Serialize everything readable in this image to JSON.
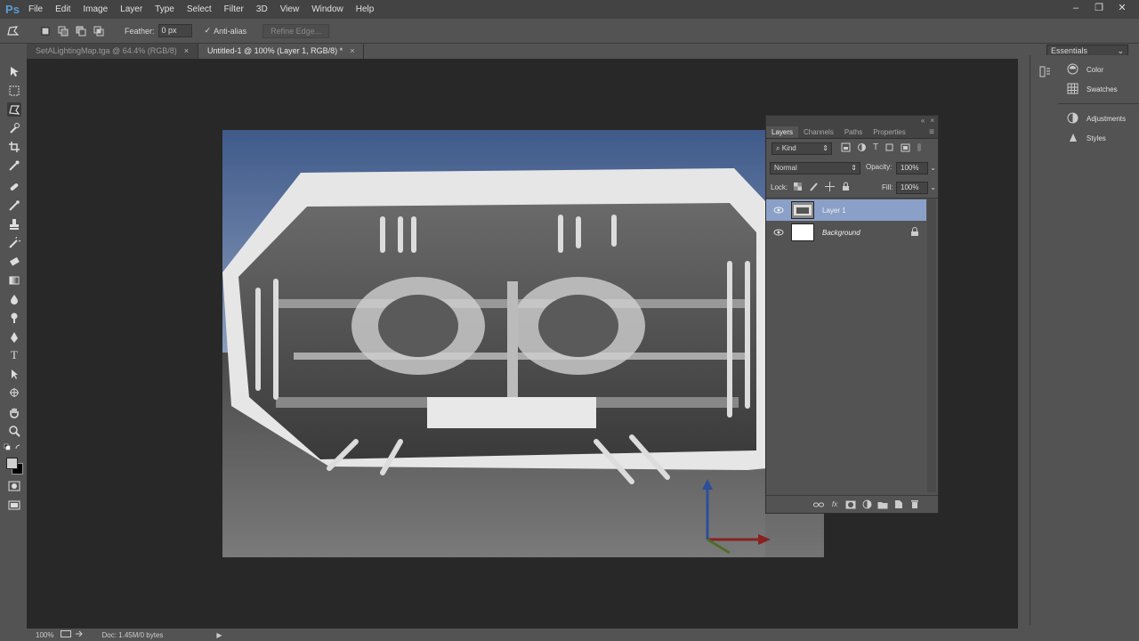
{
  "app": {
    "logo": "Ps"
  },
  "menu": [
    "File",
    "Edit",
    "Image",
    "Layer",
    "Type",
    "Select",
    "Filter",
    "3D",
    "View",
    "Window",
    "Help"
  ],
  "window_controls": {
    "minimize": "–",
    "restore": "❐",
    "close": "✕"
  },
  "options": {
    "feather_label": "Feather:",
    "feather_value": "0 px",
    "antialias_label": "Anti-alias",
    "refine_edge_label": "Refine Edge...",
    "workspace": "Essentials"
  },
  "doc_tabs": [
    {
      "label": "SetALightingMap.tga @ 64.4% (RGB/8)",
      "active": false
    },
    {
      "label": "Untitled-1 @ 100% (Layer 1, RGB/8) *",
      "active": true
    }
  ],
  "status": {
    "zoom": "100%",
    "doc": "Doc: 1.45M/0 bytes"
  },
  "right_panels": [
    {
      "label": "Color",
      "icon": "color-icon"
    },
    {
      "label": "Swatches",
      "icon": "swatches-icon"
    },
    {
      "label": "Adjustments",
      "icon": "adjustments-icon"
    },
    {
      "label": "Styles",
      "icon": "styles-icon"
    }
  ],
  "layers_panel": {
    "tabs": [
      "Layers",
      "Channels",
      "Paths",
      "Properties"
    ],
    "filter_kind": "Kind",
    "blend_mode": "Normal",
    "opacity_label": "Opacity:",
    "opacity_value": "100%",
    "lock_label": "Lock:",
    "fill_label": "Fill:",
    "fill_value": "100%",
    "layers": [
      {
        "name": "Layer 1",
        "selected": true,
        "locked": false
      },
      {
        "name": "Background",
        "selected": false,
        "locked": true
      }
    ]
  },
  "colors": {
    "accent_selection": "#8aa0c8",
    "ps_blue": "#5b9bd5"
  }
}
